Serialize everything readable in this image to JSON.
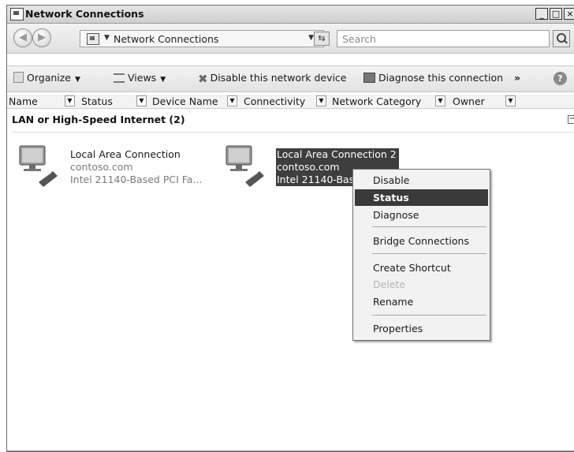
{
  "window": {
    "title": "Network Connections"
  },
  "address": {
    "path": "Network Connections",
    "search_placeholder": "Search"
  },
  "toolbar": {
    "organize": "Organize",
    "views": "Views",
    "disable": "Disable this network device",
    "diagnose": "Diagnose this connection",
    "more": "»"
  },
  "columns": [
    "Name",
    "Status",
    "Device Name",
    "Connectivity",
    "Network Category",
    "Owner"
  ],
  "group": {
    "title": "LAN or High-Speed Internet (2)"
  },
  "connections": [
    {
      "name": "Local Area Connection",
      "domain": "contoso.com",
      "device": "Intel 21140-Based PCI Fa..."
    },
    {
      "name": "Local Area Connection 2",
      "domain": "contoso.com",
      "device": "Intel 21140-Bas"
    }
  ],
  "context_menu": {
    "items": [
      "Disable",
      "Status",
      "Diagnose",
      "Bridge Connections",
      "Create Shortcut",
      "Delete",
      "Rename",
      "Properties"
    ],
    "active": "Status",
    "disabled": "Delete"
  }
}
